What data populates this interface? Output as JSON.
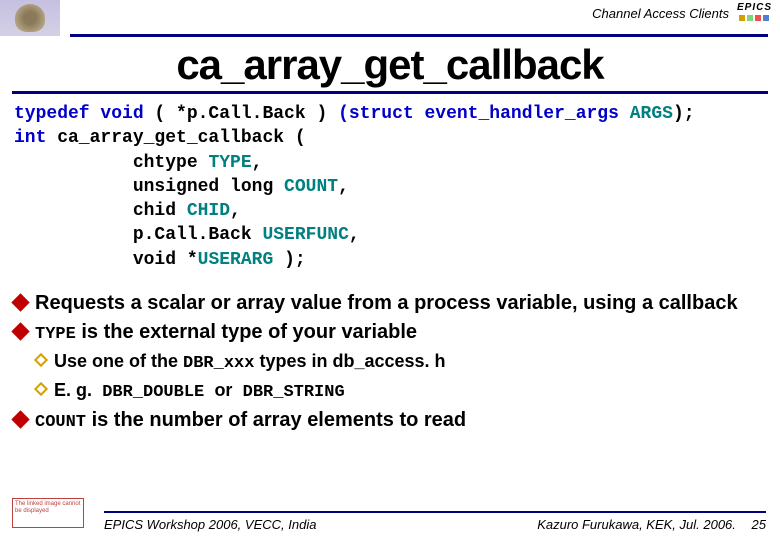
{
  "header": {
    "section": "Channel Access Clients",
    "brand": "EPICS"
  },
  "title": "ca_array_get_callback",
  "code": {
    "l1_a": "typedef void",
    "l1_b": " ( *p.Call.Back ) ",
    "l1_c": "(struct event_handler_args",
    "l1_d": " ARGS",
    "l1_e": ");",
    "l2_a": "int",
    "l2_b": " ca_array_get_callback (",
    "l3_a": "           chtype ",
    "l3_b": "TYPE",
    "l3_c": ",",
    "l4_a": "           unsigned long ",
    "l4_b": "COUNT",
    "l4_c": ",",
    "l5_a": "           chid ",
    "l5_b": "CHID",
    "l5_c": ",",
    "l6_a": "           p.Call.Back ",
    "l6_b": "USERFUNC",
    "l6_c": ",",
    "l7_a": "           void *",
    "l7_b": "USERARG",
    "l7_c": " );"
  },
  "bullets": {
    "b1": "Requests a scalar or array value from a process variable, using a callback",
    "b2_a": "TYPE",
    "b2_b": " is the external type of your variable",
    "b2s1_a": "Use",
    "b2s1_b": " one of the ",
    "b2s1_c": "DBR_xxx",
    "b2s1_d": " types in db_access. h",
    "b2s2_a": "E. g.",
    "b2s2_b": " DBR_DOUBLE ",
    "b2s2_c": "or",
    "b2s2_d": " DBR_STRING",
    "b3_a": "COUNT",
    "b3_b": " is the number of array elements to read"
  },
  "footer": {
    "left": "EPICS Workshop 2006, VECC, India",
    "right": "Kazuro Furukawa, KEK, Jul. 2006.",
    "page": "25",
    "badge": "The linked image cannot be displayed"
  }
}
